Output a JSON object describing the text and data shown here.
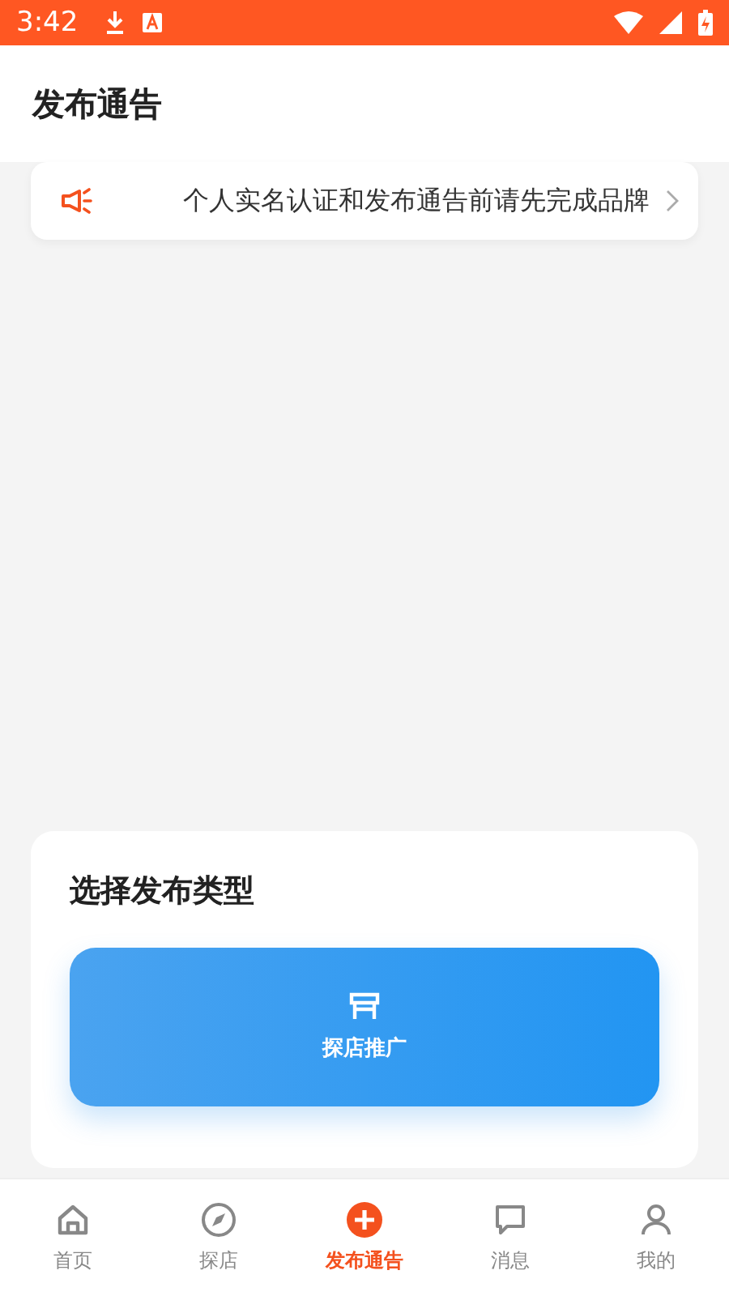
{
  "status_bar": {
    "time": "3:42"
  },
  "header": {
    "title": "发布通告"
  },
  "notice": {
    "text": "个人实名认证和发布通告前请先完成品牌"
  },
  "publish_panel": {
    "title": "选择发布类型",
    "options": [
      {
        "kind": "store",
        "label": "探店推广"
      }
    ]
  },
  "tab_bar": [
    {
      "label": "首页",
      "kind": "home",
      "selected": false
    },
    {
      "label": "探店",
      "kind": "compass",
      "selected": false
    },
    {
      "label": "发布通告",
      "kind": "plus",
      "selected": true
    },
    {
      "label": "消息",
      "kind": "message",
      "selected": false
    },
    {
      "label": "我的",
      "kind": "person",
      "selected": false
    }
  ]
}
